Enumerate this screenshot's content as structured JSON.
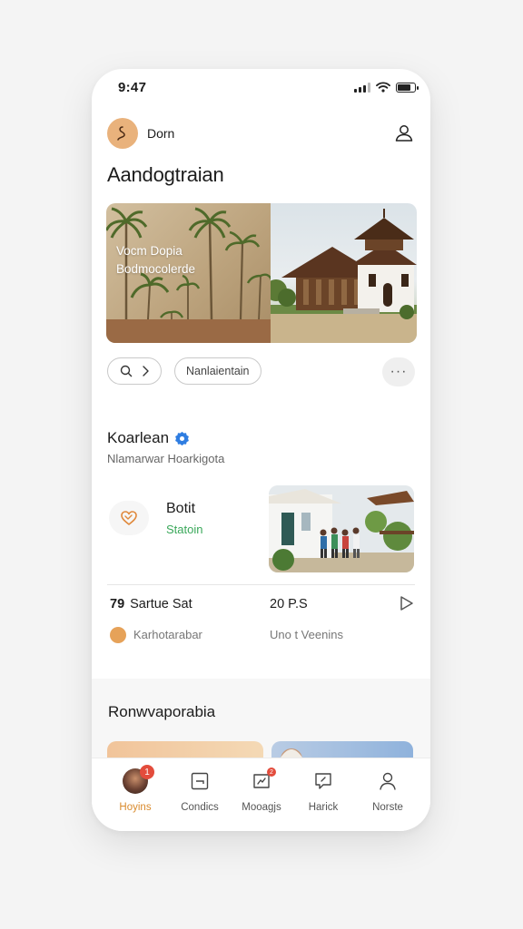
{
  "status_bar": {
    "time": "9:47"
  },
  "header": {
    "username": "Dorn",
    "title": "Aandogtraian"
  },
  "hero": {
    "line1": "Vocm Dopia",
    "line2": "Bodmocolerde"
  },
  "chips": {
    "tag_label": "Nanlaientain"
  },
  "section": {
    "title": "Koarlean",
    "subtitle": "Nlamarwar Hoarkigota"
  },
  "feature": {
    "title": "Botit",
    "status": "Statoin"
  },
  "stats": {
    "left_number": "79",
    "left_label": "Sartue Sat",
    "right_number": "20",
    "right_label": "P.S"
  },
  "meta": {
    "left": "Karhotarabar",
    "right": "Uno t Veenins"
  },
  "band": {
    "title": "Ronwvaporabia"
  },
  "tabs": [
    {
      "label": "Hoyins",
      "badge": "1"
    },
    {
      "label": "Condics"
    },
    {
      "label": "Mooagjs",
      "badge": "2"
    },
    {
      "label": "Harick"
    },
    {
      "label": "Norste"
    }
  ],
  "colors": {
    "accent": "#d98a2c",
    "success": "#27a24a",
    "badge": "#e34c3c",
    "verified": "#2f7de1"
  }
}
